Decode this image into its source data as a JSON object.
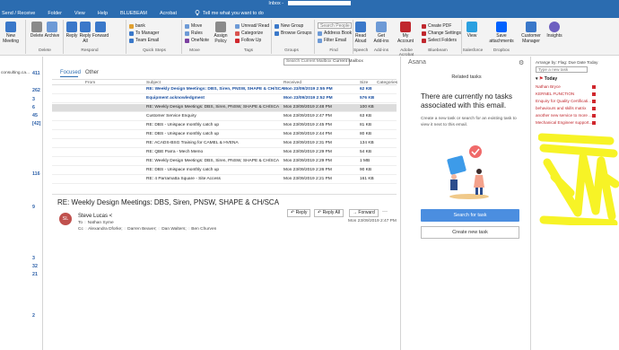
{
  "window": {
    "title": "Inbox - "
  },
  "menu": {
    "tabs": [
      "Send / Receive",
      "Folder",
      "View",
      "Help",
      "BLUEBEAM",
      "Acrobat"
    ],
    "tell_me": "Tell me what you want to do"
  },
  "ribbon": {
    "new_meeting": "New Meeting",
    "delete": "Delete",
    "archive": "Archive",
    "reply": "Reply",
    "reply_all": "Reply All",
    "forward": "Forward",
    "quick_steps": [
      "bank",
      "To Manager",
      "Team Email"
    ],
    "move": "Move",
    "rules": "Rules",
    "onenote": "OneNote",
    "assign_policy": "Assign Policy",
    "tags": [
      "Unread/ Read",
      "Categorize",
      "Follow Up"
    ],
    "new_group": "New Group",
    "browse_groups": "Browse Groups",
    "search_people_placeholder": "Search People",
    "address_book": "Address Book",
    "filter_email": "Filter Email",
    "read_aloud": "Read Aloud",
    "get_addins": "Get Add-ins",
    "my_account": "My Account",
    "create_pdf": "Create PDF",
    "change_settings": "Change Settings",
    "select_folders": "Select Folders",
    "view": "View",
    "save_attachments": "Save attachments",
    "customer_manager": "Customer Manager",
    "insights": "Insights",
    "groups": [
      "Delete",
      "Respond",
      "Quick Steps",
      "Move",
      "Tags",
      "Groups",
      "Find",
      "Speech",
      "Add-ins",
      "Adobe Acrobat",
      "Bluebeam",
      "Salesforce",
      "Dropbox"
    ]
  },
  "folders": {
    "counts": [
      "411",
      "262",
      "3",
      "6",
      "45",
      "[42]",
      "116",
      "9",
      "3",
      "32",
      "21",
      "2"
    ],
    "label_0": "consulting.ca..."
  },
  "maillist": {
    "search_placeholder": "Search Current Mailbox",
    "scope": "Current Mailbox",
    "tab_focused": "Focused",
    "tab_other": "Other",
    "columns": {
      "from": "From",
      "subject": "Subject",
      "received": "Received",
      "size": "Size",
      "categories": "Categories"
    },
    "rows": [
      {
        "subject": "RE: Weekly Design Meetings: DBS, Siren, PNSW, SHAPE & CH/SCA",
        "received": "Mon 23/09/2019 2:55 PM",
        "size": "62 KB"
      },
      {
        "subject": "Equipment acknowledgment",
        "received": "Mon 23/09/2019 2:52 PM",
        "size": "576 KB"
      },
      {
        "subject": "RE: Weekly Design Meetings: DBS, Siren, PNSW, SHAPE & CH/SCA",
        "received": "Mon 23/09/2019 2:48 PM",
        "size": "100 KB"
      },
      {
        "subject": "Customer Service Enquiry",
        "received": "Mon 23/09/2019 2:47 PM",
        "size": "63 KB"
      },
      {
        "subject": "RE: DBS - Unispace monthly catch up",
        "received": "Mon 23/09/2019 2:45 PM",
        "size": "81 KB"
      },
      {
        "subject": "RE: DBS - Unispace monthly catch up",
        "received": "Mon 23/09/2019 2:44 PM",
        "size": "80 KB"
      },
      {
        "subject": "RE: ACADS-BSG Training for CAMEL & HVENA",
        "received": "Mon 23/09/2019 2:31 PM",
        "size": "134 KB"
      },
      {
        "subject": "RE: QBE Parra - Mech Memo",
        "received": "Mon 23/09/2019 2:29 PM",
        "size": "54 KB"
      },
      {
        "subject": "RE: Weekly Design Meetings: DBS, Siren, PNSW, SHAPE & CH/SCA",
        "received": "Mon 23/09/2019 2:29 PM",
        "size": "1 MB"
      },
      {
        "subject": "RE: DBS - Unispace monthly catch up",
        "received": "Mon 23/09/2019 2:26 PM",
        "size": "90 KB"
      },
      {
        "subject": "RE: 4 Parramatta Square - Site Access",
        "received": "Mon 23/09/2019 2:21 PM",
        "size": "161 KB"
      }
    ]
  },
  "reading": {
    "subject": "RE: Weekly Design Meetings: DBS, Siren, PNSW, SHAPE & CH/SCA",
    "avatar_initials": "SL",
    "sender": "Steve Lucas <",
    "to_label": "To",
    "to": "Nathan Syme",
    "cc_label": "Cc",
    "cc": [
      "Alexandra Dforke;",
      "Darren Beaver;",
      "Dan Walters;",
      "Ben Churven"
    ],
    "reply": "Reply",
    "reply_all": "Reply All",
    "forward": "Forward",
    "date": "Mon 23/09/2019 2:47 PM"
  },
  "asana": {
    "title": "Asana",
    "related": "Related tasks",
    "heading": "There are currently no tasks associated with this email.",
    "body": "Create a new task or search for an existing task to view it next to this email.",
    "search_btn": "Search for task",
    "new_btn": "Create new task"
  },
  "todo": {
    "arrange": "Arrange by: Flag: Due Date Today",
    "search_placeholder": "Type a new task",
    "group": "Today",
    "items": [
      "Nathan Bryce",
      "KERNEL FUNCTION",
      "Enquiry for Quality Certificati...",
      "behaviours and skills matrix",
      "another new service to more ...",
      "Mechanical Engineer support..."
    ]
  },
  "colors": {
    "accent": "#2b6cb0",
    "flag": "#d0272d",
    "highlighter": "#f7f21a",
    "asana_button": "#4b8ee0"
  }
}
